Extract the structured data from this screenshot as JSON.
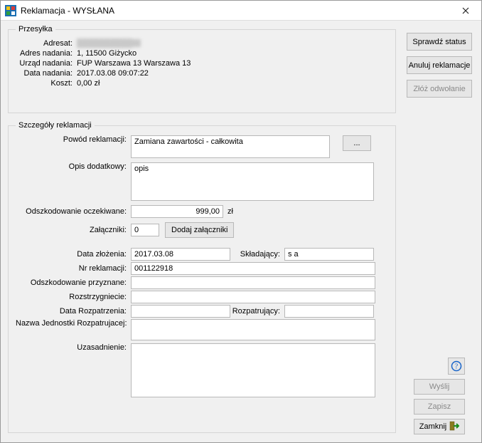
{
  "window": {
    "title": "Reklamacja - WYSŁANA"
  },
  "shipment": {
    "legend": "Przesyłka",
    "labels": {
      "adresat": "Adresat:",
      "adres_nadania": "Adres nadania:",
      "urzad_nadania": "Urząd nadania:",
      "data_nadania": "Data nadania:",
      "koszt": "Koszt:"
    },
    "values": {
      "adresat": "██████████",
      "adres_nadania": "1, 11500 Giżycko",
      "urzad_nadania": "FUP Warszawa 13 Warszawa 13",
      "data_nadania": "2017.03.08 09:07:22",
      "koszt": "0,00 zł"
    }
  },
  "actions": {
    "sprawdz_status": "Sprawdź status",
    "anuluj_reklamacje": "Anuluj reklamacje",
    "zloz_odwolanie": "Złóż odwołanie",
    "wyslij": "Wyślij",
    "zapisz": "Zapisz",
    "zamknij": "Zamknij",
    "dodaj_zalaczniki": "Dodaj załączniki",
    "more": "..."
  },
  "details": {
    "legend": "Szczegóły reklamacji",
    "labels": {
      "powod": "Powód reklamacji:",
      "opis": "Opis dodatkowy:",
      "odszk_oczek": "Odszkodowanie oczekiwane:",
      "zalaczniki": "Załączniki:",
      "data_zlozenia": "Data złożenia:",
      "skladajacy": "Składający:",
      "nr_reklamacji": "Nr reklamacji:",
      "odszk_przyzn": "Odszkodowanie przyznane:",
      "rozstrzygniecie": "Rozstrzygniecie:",
      "data_rozpatrzenia": "Data Rozpatrzenia:",
      "rozpatrujacy": "Rozpatrujący:",
      "nazwa_jednostki": "Nazwa Jednostki Rozpatrujacej:",
      "uzasadnienie": "Uzasadnienie:"
    },
    "values": {
      "powod": "Zamiana zawartości - całkowita",
      "opis": "opis ███",
      "odszk_oczek": "999,00",
      "odszk_unit": "zł",
      "zalaczniki": "0",
      "data_zlozenia": "2017.03.08",
      "skladajacy": "s a",
      "nr_reklamacji": "001122918",
      "odszk_przyzn": "",
      "rozstrzygniecie": "",
      "data_rozpatrzenia": "",
      "rozpatrujacy": "",
      "nazwa_jednostki": "",
      "uzasadnienie": ""
    }
  }
}
